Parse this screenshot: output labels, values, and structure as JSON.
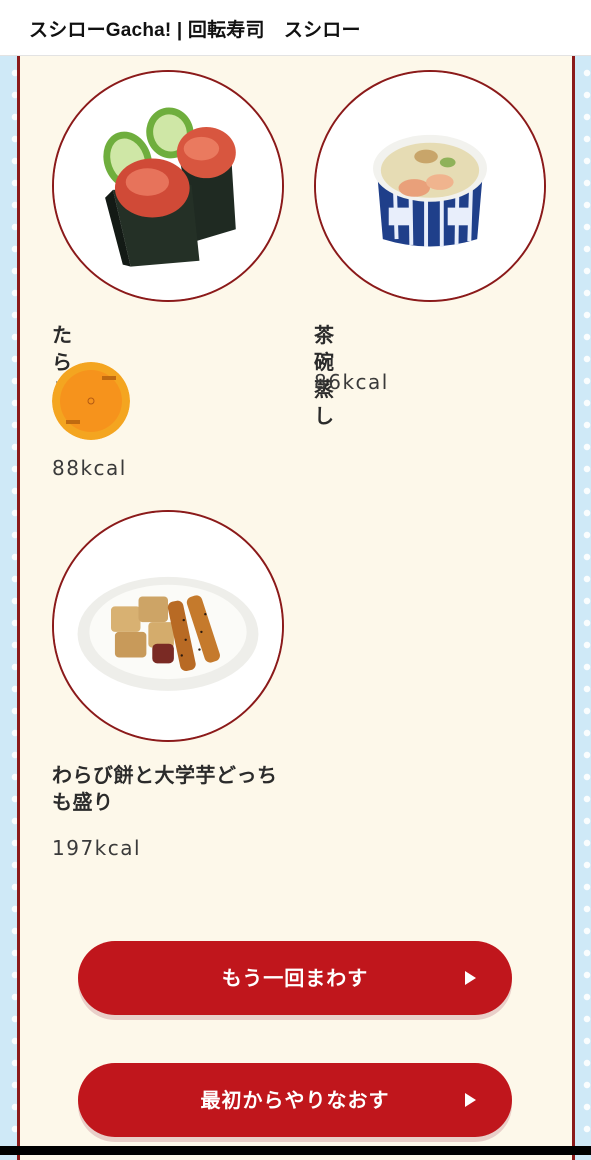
{
  "header": {
    "title": "スシローGacha! | 回転寿司　スシロー"
  },
  "colors": {
    "accent": "#c0161c",
    "border": "#8b1a1a",
    "panel_bg": "#fdf8ea",
    "page_bg": "#cfe9f7"
  },
  "items": [
    {
      "name": "たらこ",
      "kcal": "88kcal",
      "image_icon": "tarako-gunkan-image",
      "plate_icon": "orange-plate-icon"
    },
    {
      "name": "茶碗蒸し",
      "kcal": "86kcal",
      "image_icon": "chawanmushi-image"
    },
    {
      "name": "わらび餅と大学芋どっちも盛り",
      "kcal": "197kcal",
      "image_icon": "warabimochi-daigakuimo-image"
    }
  ],
  "buttons": {
    "spin_again": "もう一回まわす",
    "restart": "最初からやりなおす"
  }
}
